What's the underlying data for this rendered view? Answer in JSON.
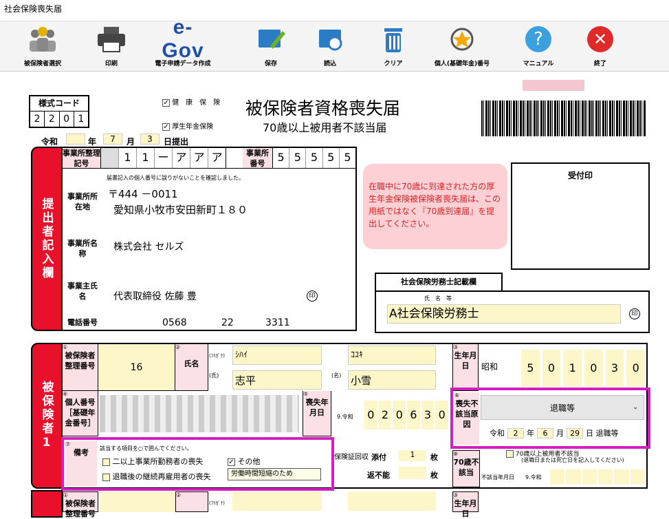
{
  "app": {
    "title": "社会保険喪失届"
  },
  "toolbar": [
    {
      "label": "被保険者選択",
      "icon": "people-icon"
    },
    {
      "label": "印刷",
      "icon": "printer-icon"
    },
    {
      "label": "電子申請データ作成",
      "icon": "egov-logo",
      "logo_text": "e-Gov"
    },
    {
      "label": "保存",
      "icon": "save-folder-icon"
    },
    {
      "label": "読込",
      "icon": "load-folder-icon"
    },
    {
      "label": "クリア",
      "icon": "trash-icon"
    },
    {
      "label": "個人(基礎年金)番号",
      "icon": "star-refresh-icon"
    },
    {
      "label": "マニュアル",
      "icon": "help-icon",
      "glyph": "?"
    },
    {
      "label": "終了",
      "icon": "close-icon",
      "glyph": "✕"
    }
  ],
  "form": {
    "style_code_label": "様式コード",
    "style_code": [
      "2",
      "2",
      "0",
      "1"
    ],
    "health_label": "健　康　保　険",
    "pension_label": "厚生年金保険",
    "title": "被保険者資格喪失届",
    "subtitle": "70歳以上被用者不該当届",
    "era": "令和",
    "year_label": "年",
    "month": "7",
    "month_label": "月",
    "day": "3",
    "day_suffix": "日提出",
    "office_code_label": "事業所整理記号",
    "office_code": [
      "1",
      "1",
      "ー",
      "ア",
      "ア",
      "ア"
    ],
    "office_no_label": "事業所番号",
    "office_no": [
      "5",
      "5",
      "5",
      "5",
      "5"
    ],
    "notice_text": "在職中に70歳に到達された方の厚生年金保険被保険者喪失届は、この用紙ではなく『70歳到達届』を提出してください。",
    "receipt_label": "受付印",
    "confirm_text": "届書記入の個人番号に誤りがないことを確認しました。",
    "postal": "〒444 －0011",
    "address_label": "事業所所在地",
    "address": "愛知県小牧市安田新町１８０",
    "name_label": "事業所名称",
    "company": "株式会社 セルズ",
    "owner_label": "事業主氏名",
    "owner": "代表取締役 佐藤 豊",
    "seal": "印",
    "phone_label": "電話番号",
    "phone1": "0568",
    "phone2": "22",
    "phone3": "3311",
    "sharoushi_title": "社会保険労務士記載欄",
    "sharoushi_name_label": "氏　名　等",
    "sharoushi_name": "A社会保険労務士",
    "side1": "提出者記入欄",
    "side2": "被保険者1"
  },
  "insured": {
    "no_label": "被保険者整理番号",
    "no": "16",
    "name_label": "氏名",
    "kana_label": "(ﾌﾘｶﾞﾅ)",
    "surname_label": "(氏)",
    "given_label": "(名)",
    "kana_sur": "ｼﾊｲ",
    "kana_given": "ｺﾕｷ",
    "surname": "志平",
    "given": "小雪",
    "birth_label": "生年月日",
    "birth_era": "昭和",
    "birth": [
      "5",
      "0",
      "1",
      "0",
      "3",
      "0"
    ],
    "birth_units": [
      "年",
      "月",
      "日"
    ],
    "mynum_label": "個人番号［基礎年金番号］",
    "loss_label": "喪失年月日",
    "loss_era": "9.令和",
    "loss": [
      "0",
      "2",
      "0",
      "6",
      "3",
      "0"
    ],
    "reason_label": "喪失不該当原因",
    "reason": "退職等",
    "reason_era": "令和",
    "reason_y": "2",
    "reason_m": "6",
    "reason_d": "29",
    "reason_suffix": "日 退職等",
    "note_label": "備考",
    "note_title": "該当する項目を○で囲んでください。",
    "note_opts": [
      "二以上事業所勤務者の喪失",
      "退職後の継続再雇用者の喪失",
      "その他"
    ],
    "note_other": "労働時間短縮のため",
    "cert_label": "保険証回収",
    "attached": "添付",
    "attached_n": "1",
    "returnless": "返不能",
    "unit": "枚",
    "over70_label": "70歳不該当",
    "over70_text": "70歳以上被用者不該当",
    "over70_sub": "(退職日または死亡日を記入してください)",
    "over70_date_label": "不該当年月日",
    "over70_era": "9.令和"
  }
}
